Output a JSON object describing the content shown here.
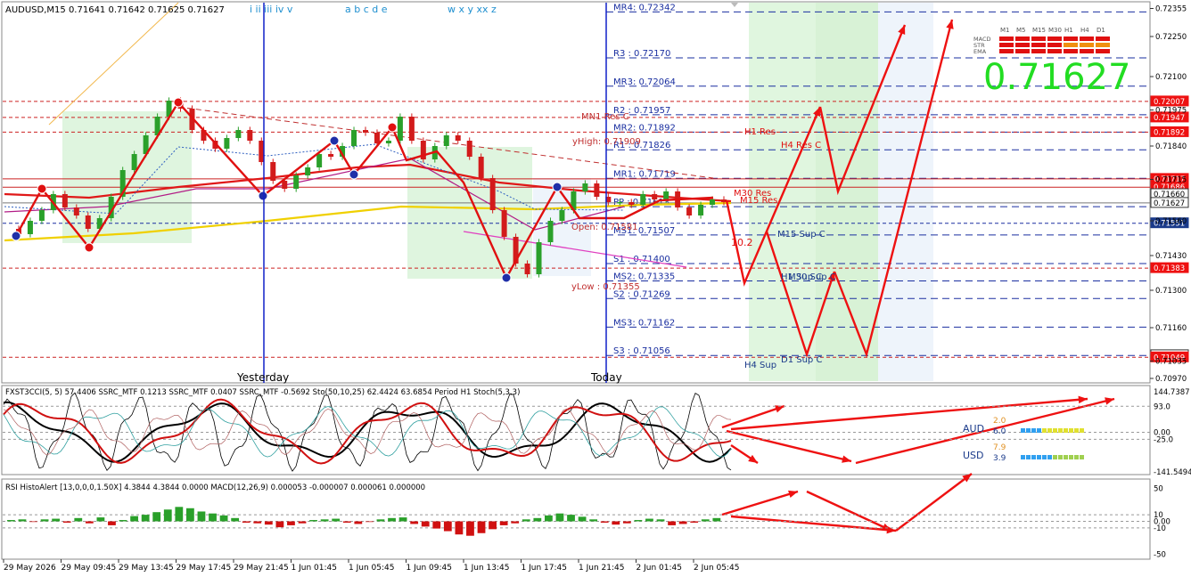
{
  "header": {
    "symbol_info": "AUDUSD,M15  0.71641 0.71642 0.71625 0.71627",
    "wave_labels": [
      "i ii iii iv v",
      "a b c d e",
      "w x y xx z"
    ]
  },
  "big_price": "0.71627",
  "mtf_panel": {
    "timeframes": [
      "M1",
      "M5",
      "M15",
      "M30",
      "H1",
      "H4",
      "D1"
    ],
    "rows": [
      "MACD",
      "STR",
      "EMA"
    ]
  },
  "chart_data": [
    {
      "type": "line",
      "panel": "price",
      "title": "AUDUSD,M15",
      "ylim": [
        0.7097,
        0.7237
      ],
      "y_ticks": [
        "0.72355",
        "0.72250",
        "0.72100",
        "0.71975",
        "0.71840",
        "0.71715",
        "0.71560",
        "0.71430",
        "0.71300",
        "0.71160",
        "0.71035",
        "0.70970"
      ],
      "price_tags": [
        {
          "value": "0.72007",
          "color": "#ee1111"
        },
        {
          "value": "0.71947",
          "color": "#ee1111"
        },
        {
          "value": "0.71892",
          "color": "#ee1111"
        },
        {
          "value": "0.71717",
          "color": "#ee1111"
        },
        {
          "value": "0.71686",
          "color": "#ee1111"
        },
        {
          "value": "0.71660",
          "color": "#ffffff"
        },
        {
          "value": "0.71627",
          "color": "#ffffff"
        },
        {
          "value": "0.71551",
          "color": "#1a3a8a"
        },
        {
          "value": "0.71383",
          "color": "#ee1111"
        },
        {
          "value": "0.71057",
          "color": "#ffffff"
        },
        {
          "value": "0.71049",
          "color": "#ee1111"
        }
      ],
      "levels": [
        {
          "label": "MR4: 0.72342",
          "value": 0.72342
        },
        {
          "label": "R3 : 0.72170",
          "value": 0.7217
        },
        {
          "label": "MR3: 0.72064",
          "value": 0.72064
        },
        {
          "label": "R2 : 0.71957",
          "value": 0.71957
        },
        {
          "label": "MR2: 0.71892",
          "value": 0.71892
        },
        {
          "label": "R1 : 0.71826",
          "value": 0.71826
        },
        {
          "label": "MR1: 0.71719",
          "value": 0.71719
        },
        {
          "label": "PP : 0.71613",
          "value": 0.71613
        },
        {
          "label": "MS1: 0.71507",
          "value": 0.71507
        },
        {
          "label": "S1 : 0.71400",
          "value": 0.714
        },
        {
          "label": "MS2: 0.71335",
          "value": 0.71335
        },
        {
          "label": "S2 : 0.71269",
          "value": 0.71269
        },
        {
          "label": "MS3: 0.71162",
          "value": 0.71162
        },
        {
          "label": "S3 : 0.71056",
          "value": 0.71056
        }
      ],
      "annotations": [
        "MN1 Res C",
        "yHigh: 0.71909",
        "yLow : 0.71355",
        "Open: 0.71581",
        "H1 Res",
        "H4 Res C",
        "M30 Res",
        "M15 Res",
        "M15 Sup C",
        "H1 Sup C",
        "M30 Sup C",
        "D1 Sup C",
        "H4 Sup",
        "10.2",
        "Yesterday",
        "Today"
      ],
      "series": [
        {
          "values": [
            0.7153,
            0.7151,
            0.7156,
            0.716,
            0.7166,
            0.7161,
            0.7158,
            0.7153,
            0.7157,
            0.7165,
            0.7175,
            0.7181,
            0.7188,
            0.7195,
            0.7201,
            0.7198,
            0.719,
            0.7186,
            0.7183,
            0.7187,
            0.719,
            0.7186,
            0.7178,
            0.7171,
            0.7168,
            0.7173,
            0.7176,
            0.7181,
            0.718,
            0.7184,
            0.719,
            0.7189,
            0.7185,
            0.7186,
            0.7195,
            0.7186,
            0.7179,
            0.7184,
            0.7188,
            0.7186,
            0.718,
            0.7172,
            0.716,
            0.715,
            0.714,
            0.7136,
            0.7148,
            0.7156,
            0.716,
            0.7167,
            0.717,
            0.7165,
            0.7163,
            0.7163,
            0.7162,
            0.7166,
            0.7164,
            0.7167,
            0.7161,
            0.7158,
            0.7162,
            0.7164,
            0.7163
          ]
        }
      ]
    },
    {
      "type": "line",
      "panel": "oscillator",
      "title": "FXST3CCI(5, 5) 57.4406  SSRC_MTF 0.1213  SSRC_MTF 0.0407  SSRC_MTF -0.5692  Sto(50,10,25) 62.4424 63.6854  Period H1 Stoch(5,3,3)",
      "y_ticks": [
        "144.7387",
        "93.0",
        "0.00",
        "-25.0",
        "-141.5494"
      ],
      "strength": [
        {
          "currency": "AUD",
          "value": "6.0",
          "top": "2.0"
        },
        {
          "currency": "USD",
          "value": "3.9",
          "top": "7.9"
        }
      ]
    },
    {
      "type": "bar",
      "panel": "histogram",
      "title": "RSI HistoAlert [13,0,0,0,1.50X] 4.3844 4.3844 0.0000  MACD(12,26,9) 0.000053 -0.000007 0.000061 0.000000",
      "y_ticks": [
        "50",
        "10",
        "0.00",
        "-10",
        "-50"
      ],
      "values": [
        2,
        3,
        -1,
        3,
        4,
        -2,
        5,
        -3,
        6,
        -6,
        2,
        8,
        10,
        14,
        18,
        22,
        20,
        15,
        12,
        9,
        5,
        -2,
        -3,
        -5,
        -9,
        -6,
        -3,
        2,
        3,
        4,
        -2,
        -4,
        -1,
        3,
        5,
        6,
        -4,
        -8,
        -11,
        -15,
        -20,
        -22,
        -18,
        -12,
        -6,
        -3,
        3,
        5,
        9,
        12,
        10,
        7,
        3,
        -2,
        -5,
        -3,
        2,
        4,
        3,
        -6,
        -4,
        -2,
        3,
        5
      ]
    }
  ],
  "x_axis": [
    "29 May 2026",
    "29 May 09:45",
    "29 May 13:45",
    "29 May 17:45",
    "29 May 21:45",
    "1 Jun 01:45",
    "1 Jun 05:45",
    "1 Jun 09:45",
    "1 Jun 13:45",
    "1 Jun 17:45",
    "1 Jun 21:45",
    "2 Jun 01:45",
    "2 Jun 05:45"
  ],
  "colors": {
    "background": "#ffffff",
    "bull_candle": "#2aa02a",
    "bear_candle": "#d21b1b",
    "pivot": "#1f2fa8",
    "forecast": "#ee1111",
    "price_big": "#22dd22"
  }
}
